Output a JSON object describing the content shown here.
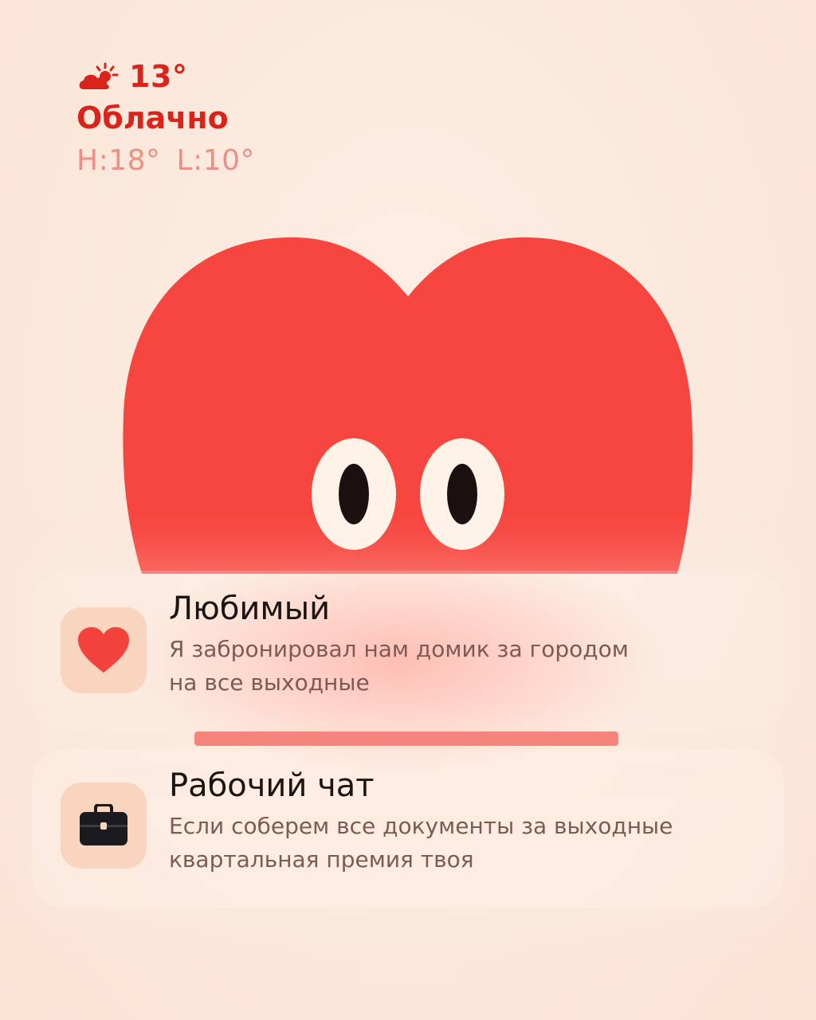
{
  "weather": {
    "icon": "cloud-sun-icon",
    "temperature": "13°",
    "condition": "Облачно",
    "high": "H:18°",
    "low": "L:10°"
  },
  "notifications": [
    {
      "app_icon": "heart-icon",
      "title": "Любимый",
      "body": "Я забронировал нам домик за городом\nна все выходные"
    },
    {
      "app_icon": "briefcase-icon",
      "title": "Рабочий чат",
      "body": "Если соберем все документы за выходные\nквартальная премия твоя"
    }
  ],
  "colors": {
    "background": "#fbe8dc",
    "accent_red": "#d9241c",
    "heart": "#f7463f",
    "muted_red": "#ef8f84",
    "icon_bg": "#f9d4bf"
  }
}
